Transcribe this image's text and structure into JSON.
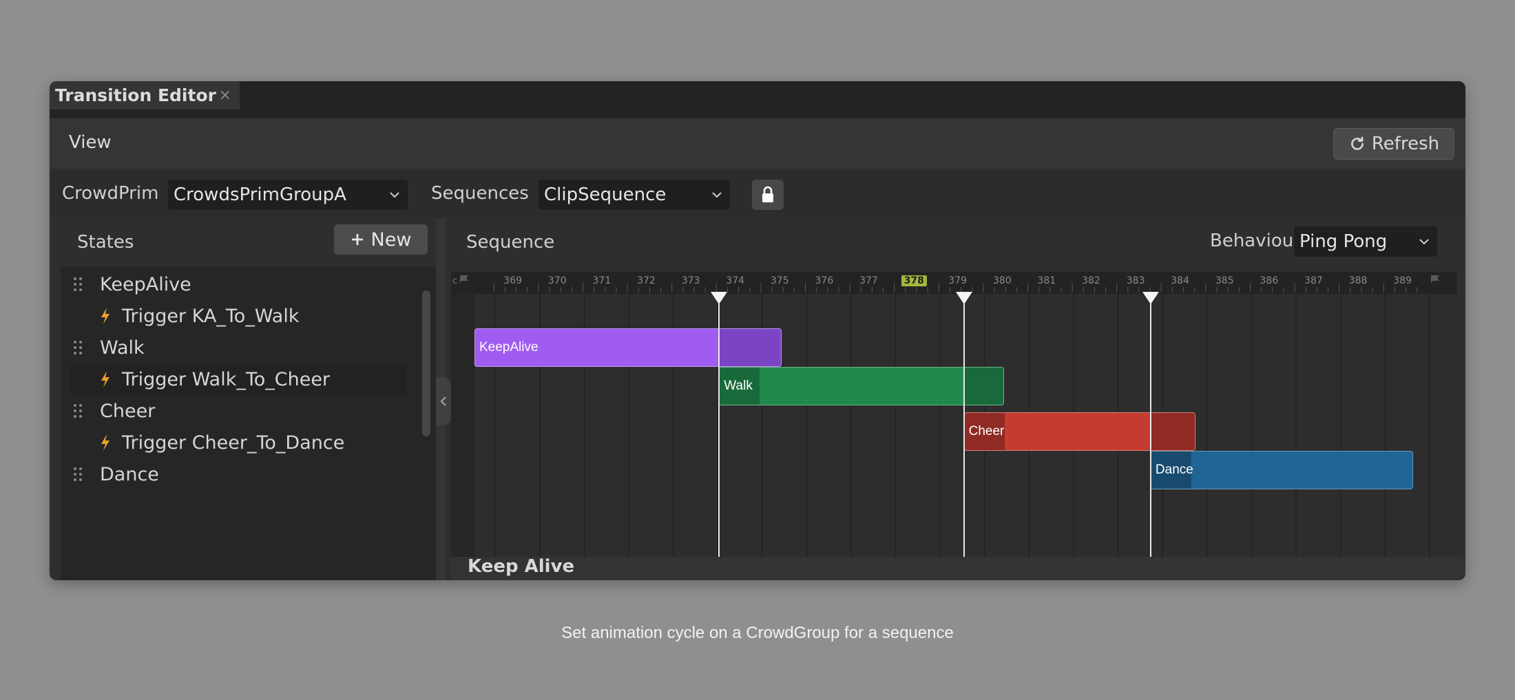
{
  "window": {
    "tab_title": "Transition Editor",
    "tab_close": "×"
  },
  "menubar": {
    "view_label": "View",
    "refresh_label": "Refresh"
  },
  "toolbar": {
    "crowdprim_label": "CrowdPrim",
    "crowdprim_value": "CrowdsPrimGroupA",
    "sequences_label": "Sequences",
    "sequences_value": "ClipSequence"
  },
  "states_panel": {
    "title": "States",
    "new_label": "New",
    "items": [
      {
        "label": "KeepAlive",
        "trigger": "Trigger KA_To_Walk"
      },
      {
        "label": "Walk",
        "trigger": "Trigger Walk_To_Cheer"
      },
      {
        "label": "Cheer",
        "trigger": "Trigger Cheer_To_Dance"
      },
      {
        "label": "Dance"
      }
    ]
  },
  "sequence_panel": {
    "title": "Sequence",
    "behaviour_label": "Behaviour",
    "behaviour_value": "Ping Pong",
    "ruler_ticks": [
      "369",
      "370",
      "371",
      "372",
      "373",
      "374",
      "375",
      "376",
      "377",
      "378",
      "379",
      "380",
      "381",
      "382",
      "383",
      "384",
      "385",
      "386",
      "387",
      "388",
      "389"
    ],
    "current_frame": "378",
    "transition_frames": [
      374,
      379.5,
      383.7
    ],
    "clips": [
      {
        "label": "KeepAlive",
        "start": 368.5,
        "end": 375.4,
        "color": "#a05cf0",
        "dark": "#7a44c2",
        "fade_start": 374.0,
        "fade_end": 375.4
      },
      {
        "label": "Walk",
        "start": 374.0,
        "end": 380.4,
        "color": "#1f8a4c",
        "dark": "#196a3b",
        "fade_start": 379.5,
        "fade_end": 380.4
      },
      {
        "label": "Cheer",
        "start": 379.5,
        "end": 384.7,
        "color": "#c63b2f",
        "dark": "#8f2a24",
        "fade_start": 383.7,
        "fade_end": 384.7
      },
      {
        "label": "Dance",
        "start": 383.7,
        "end": 389.6,
        "color": "#1f6596",
        "dark": "#194b70",
        "fade_start": 389.6,
        "fade_end": 389.6
      }
    ],
    "bottom_title": "Keep Alive"
  },
  "caption": "Set animation cycle on a CrowdGroup for a sequence"
}
